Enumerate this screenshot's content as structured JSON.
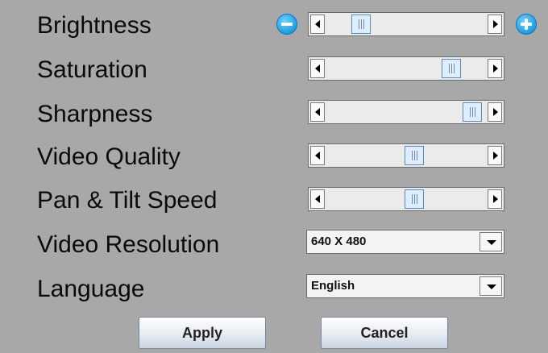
{
  "settings": [
    {
      "label": "Brightness",
      "control": "slider",
      "value_pct": 18,
      "has_adjust_buttons": true
    },
    {
      "label": "Saturation",
      "control": "slider",
      "value_pct": 82
    },
    {
      "label": "Sharpness",
      "control": "slider",
      "value_pct": 97
    },
    {
      "label": "Video Quality",
      "control": "slider",
      "value_pct": 56
    },
    {
      "label": "Pan & Tilt Speed",
      "control": "slider",
      "value_pct": 56
    },
    {
      "label": "Video Resolution",
      "control": "dropdown",
      "value": "640 X 480"
    },
    {
      "label": "Language",
      "control": "dropdown",
      "value": "English"
    }
  ],
  "icons": {
    "decrease": "minus-circle-icon",
    "increase": "plus-circle-icon",
    "scroll_left": "arrow-left-icon",
    "scroll_right": "arrow-right-icon",
    "dropdown": "chevron-down-icon"
  },
  "buttons": {
    "apply": "Apply",
    "cancel": "Cancel"
  },
  "colors": {
    "background": "#a8a8a8",
    "accent": "#1a9ae0"
  }
}
